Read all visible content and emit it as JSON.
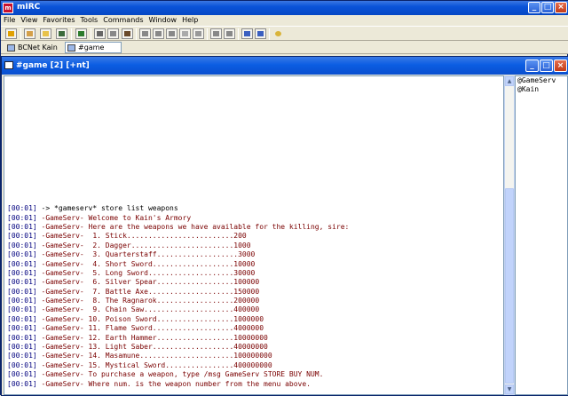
{
  "app": {
    "title": "mIRC",
    "logo_text": "m"
  },
  "menu": [
    "File",
    "View",
    "Favorites",
    "Tools",
    "Commands",
    "Window",
    "Help"
  ],
  "switchbar": [
    {
      "label": "BCNet Kain",
      "active": false
    },
    {
      "label": "#game",
      "active": true
    }
  ],
  "channel": {
    "title": "#game [2] [+nt]",
    "lines": [
      {
        "ts": "[00:01]",
        "nick": "->",
        "text": " *gameserv* store list weapons",
        "own": true
      },
      {
        "ts": "[00:01]",
        "nick": "-GameServ-",
        "text": " Welcome to Kain's Armory"
      },
      {
        "ts": "[00:01]",
        "nick": "-GameServ-",
        "text": " Here are the weapons we have available for the killing, sire:"
      },
      {
        "ts": "[00:01]",
        "nick": "-GameServ-",
        "text": "  1. Stick.........................200"
      },
      {
        "ts": "[00:01]",
        "nick": "-GameServ-",
        "text": "  2. Dagger........................1000"
      },
      {
        "ts": "[00:01]",
        "nick": "-GameServ-",
        "text": "  3. Quarterstaff...................3000"
      },
      {
        "ts": "[00:01]",
        "nick": "-GameServ-",
        "text": "  4. Short Sword...................10000"
      },
      {
        "ts": "[00:01]",
        "nick": "-GameServ-",
        "text": "  5. Long Sword....................30000"
      },
      {
        "ts": "[00:01]",
        "nick": "-GameServ-",
        "text": "  6. Silver Spear..................100000"
      },
      {
        "ts": "[00:01]",
        "nick": "-GameServ-",
        "text": "  7. Battle Axe....................150000"
      },
      {
        "ts": "[00:01]",
        "nick": "-GameServ-",
        "text": "  8. The Ragnarok..................200000"
      },
      {
        "ts": "[00:01]",
        "nick": "-GameServ-",
        "text": "  9. Chain Saw.....................400000"
      },
      {
        "ts": "[00:01]",
        "nick": "-GameServ-",
        "text": " 10. Poison Sword..................1000000"
      },
      {
        "ts": "[00:01]",
        "nick": "-GameServ-",
        "text": " 11. Flame Sword...................4000000"
      },
      {
        "ts": "[00:01]",
        "nick": "-GameServ-",
        "text": " 12. Earth Hammer..................10000000"
      },
      {
        "ts": "[00:01]",
        "nick": "-GameServ-",
        "text": " 13. Light Saber...................40000000"
      },
      {
        "ts": "[00:01]",
        "nick": "-GameServ-",
        "text": " 14. Masamune......................100000000"
      },
      {
        "ts": "[00:01]",
        "nick": "-GameServ-",
        "text": " 15. Mystical Sword................400000000"
      },
      {
        "ts": "[00:01]",
        "nick": "-GameServ-",
        "text": " To purchase a weapon, type /msg GameServ STORE BUY NUM."
      },
      {
        "ts": "[00:01]",
        "nick": "-GameServ-",
        "text": " Where num. is the weapon number from the menu above."
      }
    ]
  },
  "nicklist": [
    "@GameServ",
    "@Kain"
  ],
  "colors": {
    "title_blue": "#0A53D8",
    "timestamp": "#00007F",
    "notice": "#7A0000"
  }
}
